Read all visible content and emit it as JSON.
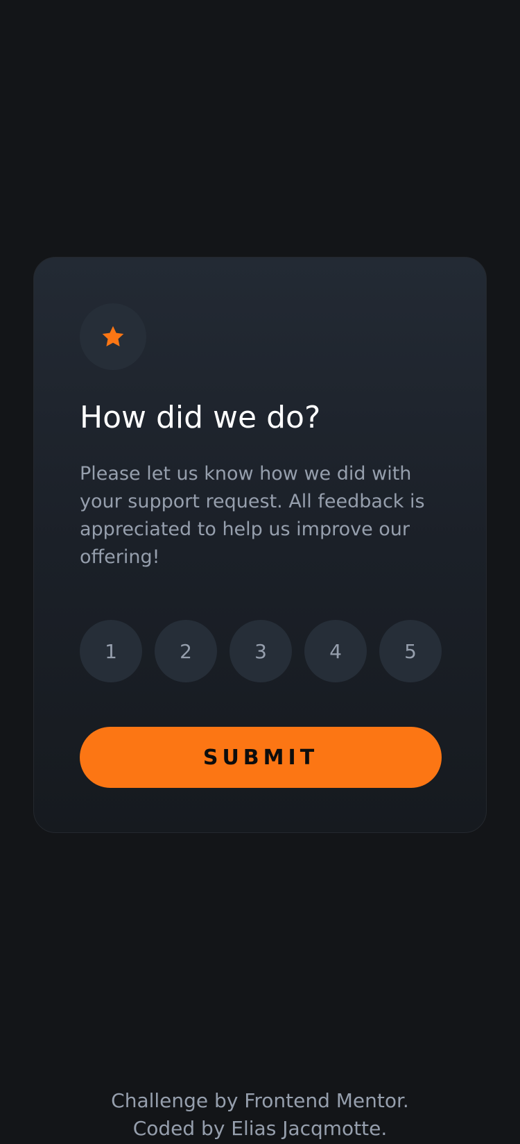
{
  "card": {
    "icon": "star-icon",
    "title": "How did we do?",
    "description": "Please let us know how we did with your support request. All feedback is appreciated to help us improve our offering!",
    "ratings": [
      "1",
      "2",
      "3",
      "4",
      "5"
    ],
    "submit_label": "SUBMIT"
  },
  "attribution": {
    "line1": "Challenge by Frontend Mentor.",
    "line2": "Coded by Elias Jacqmotte."
  },
  "colors": {
    "background": "#131518",
    "accent": "#fc7614",
    "rating_bg": "#262e38",
    "muted_text": "#969fad",
    "heading": "#ffffff"
  }
}
